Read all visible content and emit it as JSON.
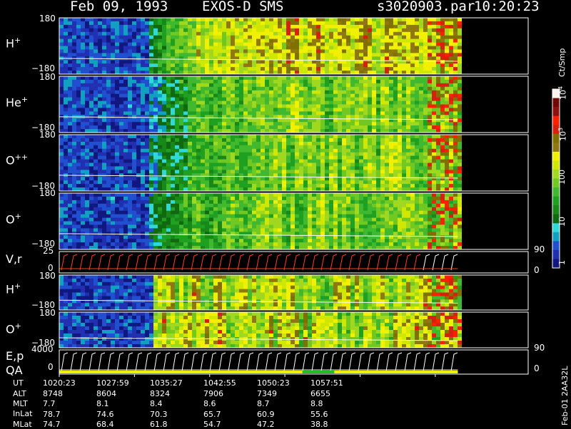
{
  "header": {
    "date": "Feb 09, 1993",
    "instrument": "EXOS-D SMS",
    "file": "s3020903.par",
    "time": "10:20:23"
  },
  "colorbar": {
    "label": "Ct/Smp",
    "ticks": [
      "1",
      "10",
      "100",
      "10",
      "10"
    ],
    "tick_powers": [
      "",
      "",
      "",
      "3",
      "4"
    ],
    "colors": [
      "#101880",
      "#2030b0",
      "#2050d0",
      "#10a0c0",
      "#30d8d8",
      "#106810",
      "#188818",
      "#20a020",
      "#40b830",
      "#70c820",
      "#a0d820",
      "#d0e800",
      "#f0f000",
      "#907810",
      "#807000",
      "#d82010",
      "#ff2000",
      "#901010",
      "#700808",
      "#fff0f0"
    ]
  },
  "panels": [
    {
      "id": "H",
      "label": "H",
      "sup": "+",
      "ytop": "180",
      "ybot": "−180"
    },
    {
      "id": "He",
      "label": "He",
      "sup": "+",
      "ytop": "180",
      "ybot": "−180"
    },
    {
      "id": "Opp",
      "label": "O",
      "sup": "++",
      "ytop": "180",
      "ybot": "−180"
    },
    {
      "id": "O",
      "label": "O",
      "sup": "+",
      "ytop": "180",
      "ybot": "−180"
    },
    {
      "id": "Vr",
      "label": "V,r",
      "sup": "",
      "ytop": "25",
      "ybot": "0",
      "rtop": "90",
      "rbot": "0"
    },
    {
      "id": "H2",
      "label": "H",
      "sup": "+",
      "ytop": "180",
      "ybot": "−180"
    },
    {
      "id": "O2",
      "label": "O",
      "sup": "+",
      "ytop": "180",
      "ybot": "−180"
    },
    {
      "id": "Ep",
      "label": "E,p",
      "label2": "QA",
      "sup": "",
      "ytop": "4000",
      "ybot": "0",
      "rtop": "90",
      "rbot": "0"
    }
  ],
  "side_label": "Feb-01 2AA32L",
  "ephemeris": {
    "rows": [
      "UT",
      "ALT",
      "MLT",
      "InLat",
      "MLat"
    ],
    "columns": [
      [
        "1020:23",
        "8748",
        "7.7",
        "78.7",
        "74.7"
      ],
      [
        "1027:59",
        "8604",
        "8.1",
        "74.6",
        "68.4"
      ],
      [
        "1035:27",
        "8324",
        "8.4",
        "70.3",
        "61.8"
      ],
      [
        "1042:55",
        "7906",
        "8.6",
        "65.7",
        "54.7"
      ],
      [
        "1050:23",
        "7349",
        "8.7",
        "60.9",
        "47.2"
      ],
      [
        "1057:51",
        "6655",
        "8.8",
        "55.6",
        "38.8"
      ]
    ]
  },
  "chart_data": {
    "type": "heatmap",
    "title": "Feb 09, 1993   EXOS-D SMS",
    "x_ticks": [
      "1020:23",
      "1027:59",
      "1035:27",
      "1042:55",
      "1050:23",
      "1057:51"
    ],
    "color_scale": "log",
    "color_range": [
      1,
      10000
    ],
    "data_extent_fraction": 0.85
  }
}
